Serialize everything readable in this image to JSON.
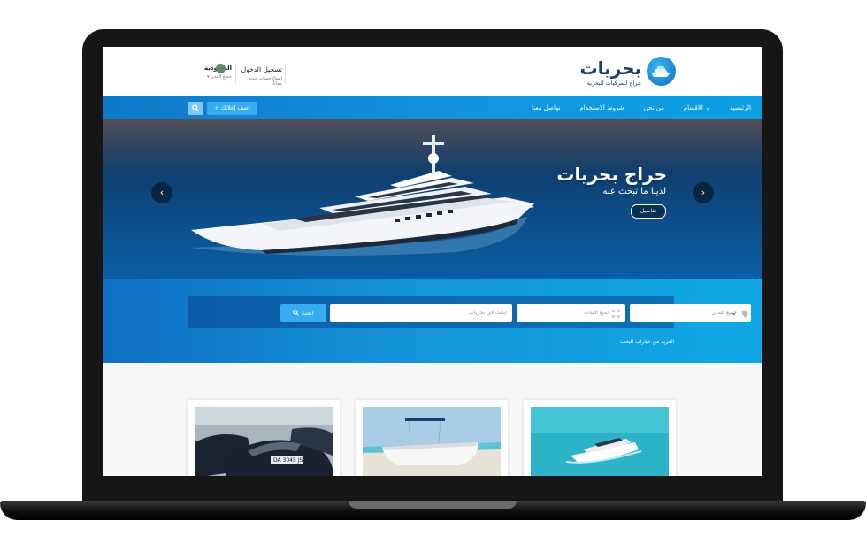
{
  "site": {
    "name": "بحريات",
    "tagline": "حراج للمركبات البحرية"
  },
  "account": {
    "login": "تسجيل الدخول",
    "create_account": "إنشاء حساب جديد مجاناً"
  },
  "region": {
    "country": "السعودية",
    "city": "جميع المدن ▾"
  },
  "nav": {
    "items": [
      "الرئيسية",
      "الاقسام ⌄",
      "من نحن",
      "شروط الاستخدام",
      "تواصل معنا"
    ],
    "add_ad": "+ أضف إعلانك"
  },
  "hero": {
    "title": "حراج بحريات",
    "subtitle": "لدينا ما تبحث عنه",
    "details_button": "تفاصيل",
    "prev": "‹",
    "next": "›"
  },
  "search": {
    "city_placeholder": "جميع المدن",
    "category_placeholder": "جميع الفئات",
    "text_placeholder": "ابحث في بحريات",
    "button": "ابحث",
    "more_options": "+ المزيد من خيارات البحث"
  },
  "colors": {
    "brand": "#1d3f6a",
    "accent": "#36adf0",
    "nav": "#1296de"
  }
}
